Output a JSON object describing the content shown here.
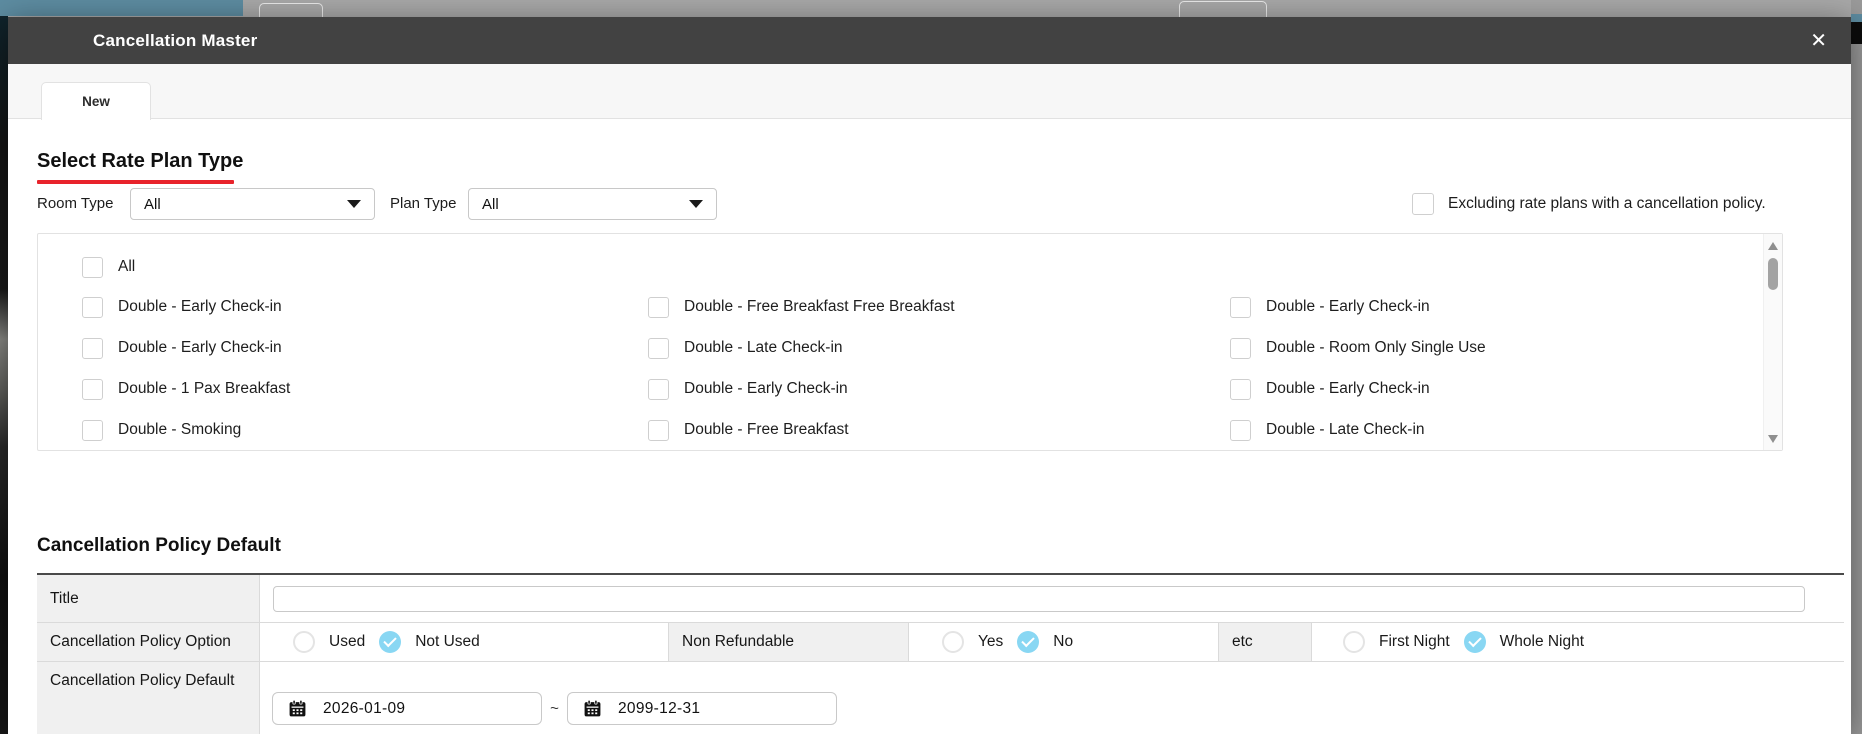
{
  "window": {
    "title": "Cancellation Master",
    "close_icon": "✕"
  },
  "tabs": [
    {
      "label": "New",
      "active": true
    }
  ],
  "rate_plan": {
    "heading": "Select Rate Plan Type",
    "filters": [
      {
        "label": "Room Type",
        "value": "All"
      },
      {
        "label": "Plan Type",
        "value": "All"
      }
    ],
    "exclude": {
      "label": "Excluding rate plans with a cancellation policy.",
      "checked": false
    },
    "select_all_label": "All",
    "select_all_checked": false,
    "plans": [
      [
        "Double - Early Check-in",
        "Double - Free Breakfast Free Breakfast",
        "Double - Early Check-in"
      ],
      [
        "Double - Early Check-in",
        "Double - Late Check-in",
        "Double - Room Only Single Use"
      ],
      [
        "Double - 1 Pax Breakfast",
        "Double - Early Check-in",
        "Double - Early Check-in"
      ],
      [
        "Double - Smoking",
        "Double - Free Breakfast",
        "Double - Late Check-in"
      ]
    ]
  },
  "policy": {
    "heading": "Cancellation Policy Default",
    "title_label": "Title",
    "title_value": "",
    "option_label": "Cancellation Policy Option",
    "used_group": {
      "radios": [
        {
          "label": "Used",
          "selected": false
        },
        {
          "label": "Not Used",
          "selected": true
        }
      ]
    },
    "non_refundable_label": "Non Refundable",
    "non_refundable_group": {
      "radios": [
        {
          "label": "Yes",
          "selected": false
        },
        {
          "label": "No",
          "selected": true
        }
      ]
    },
    "etc_label": "etc",
    "etc_group": {
      "radios": [
        {
          "label": "First Night",
          "selected": false
        },
        {
          "label": "Whole Night",
          "selected": true
        }
      ]
    },
    "default_label": "Cancellation Policy Default",
    "date_range": {
      "from": "2026-01-09",
      "separator": "~",
      "to": "2099-12-31"
    }
  },
  "colors": {
    "accent_red": "#e8232b",
    "radio_selected_blue": "#89d7f3",
    "header_dark": "#424242",
    "background_teal": "#5d8ca1",
    "background_gray": "#a8a8a8"
  }
}
